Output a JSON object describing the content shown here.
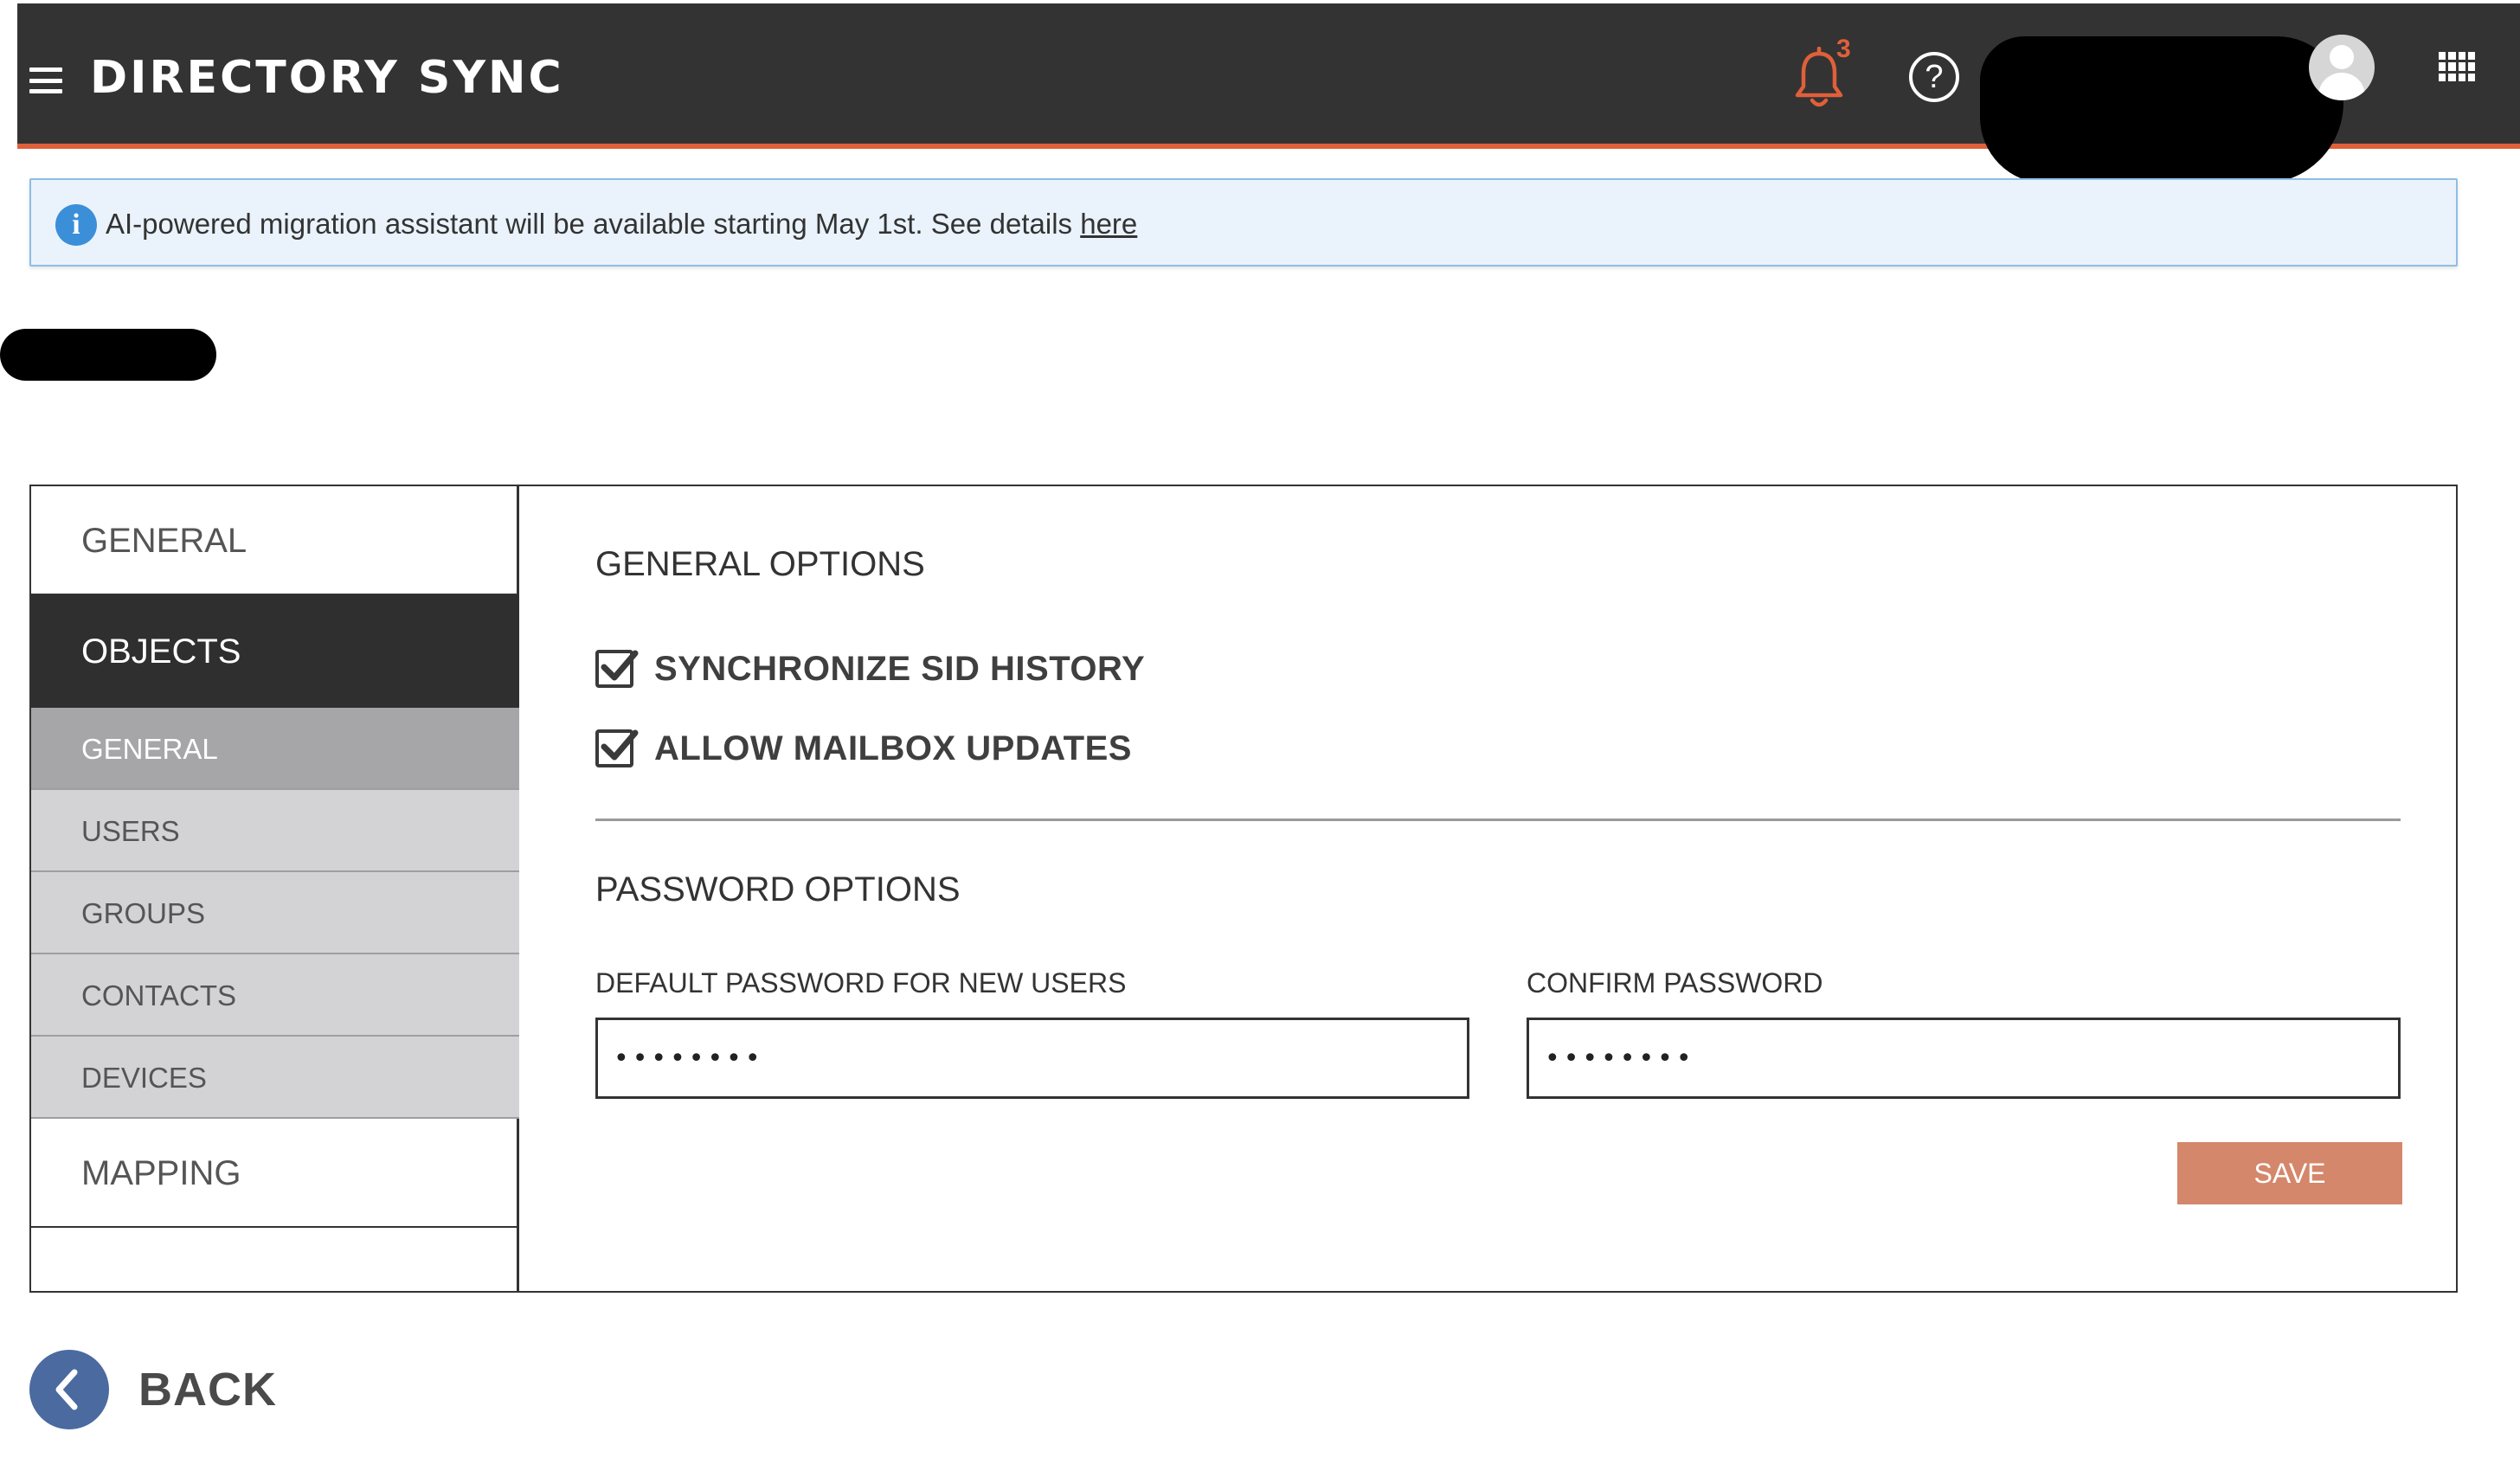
{
  "header": {
    "app_title": "DIRECTORY SYNC",
    "notification_count": "3",
    "help_glyph": "?",
    "icons": [
      "menu-icon",
      "bell-icon",
      "help-icon",
      "avatar",
      "apps-grid-icon"
    ],
    "accent_color": "#e0603a",
    "bar_color": "#333333"
  },
  "banner": {
    "icon_glyph": "i",
    "message": "AI-powered migration assistant will be available starting May 1st. See details ",
    "link_text": "here",
    "background_color": "#eaf3fc"
  },
  "sidebar": {
    "general": "GENERAL",
    "objects": "OBJECTS",
    "sub_items": [
      {
        "label": "GENERAL",
        "active": true
      },
      {
        "label": "USERS",
        "active": false
      },
      {
        "label": "GROUPS",
        "active": false
      },
      {
        "label": "CONTACTS",
        "active": false
      },
      {
        "label": "DEVICES",
        "active": false
      }
    ],
    "mapping": "MAPPING"
  },
  "general_options": {
    "title": "GENERAL OPTIONS",
    "synchronize_sid_history": {
      "label": "SYNCHRONIZE SID HISTORY",
      "checked": true
    },
    "allow_mailbox_updates": {
      "label": "ALLOW MAILBOX UPDATES",
      "checked": true
    }
  },
  "password_options": {
    "title": "PASSWORD OPTIONS",
    "default_password_label": "DEFAULT PASSWORD FOR NEW USERS",
    "default_password_value": "••••••••",
    "confirm_password_label": "CONFIRM PASSWORD",
    "confirm_password_value": "••••••••"
  },
  "actions": {
    "save_label": "SAVE",
    "save_color": "#d4876b",
    "back_label": "BACK"
  }
}
